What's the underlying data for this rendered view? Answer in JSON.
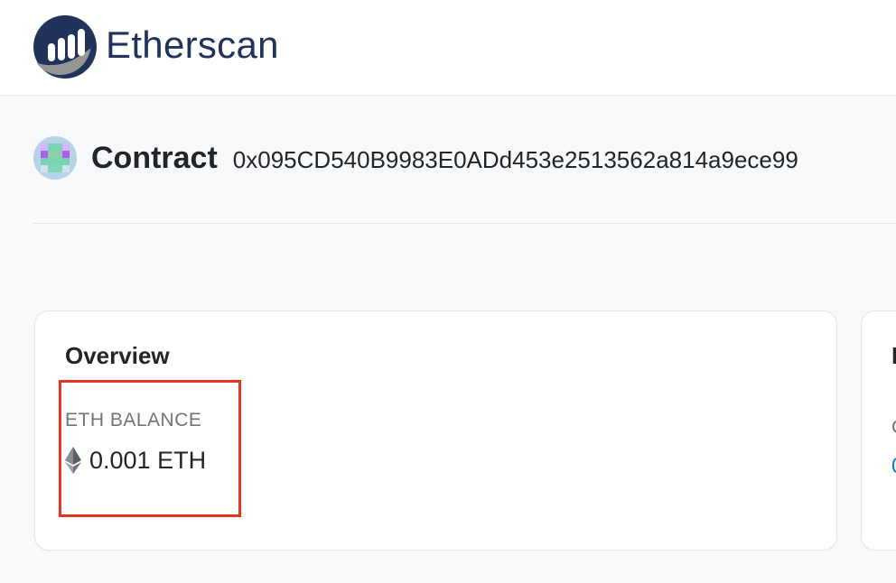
{
  "header": {
    "logo_text": "Etherscan",
    "brand_color": "#21325b",
    "logo_icon": "etherscan-logo-icon"
  },
  "page": {
    "title": "Contract",
    "address": "0x095CD540B9983E0ADd453e2513562a814a9ece99",
    "avatar_icon": "identicon-avatar"
  },
  "overview": {
    "title": "Overview",
    "eth_balance_label": "ETH BALANCE",
    "eth_balance_value": "0.001 ETH",
    "eth_icon": "ethereum-diamond-icon"
  },
  "more_card": {
    "title_partial": "M",
    "label_partial": "C",
    "link_partial": "0"
  },
  "annotation": {
    "highlight_color": "#e2361f"
  }
}
